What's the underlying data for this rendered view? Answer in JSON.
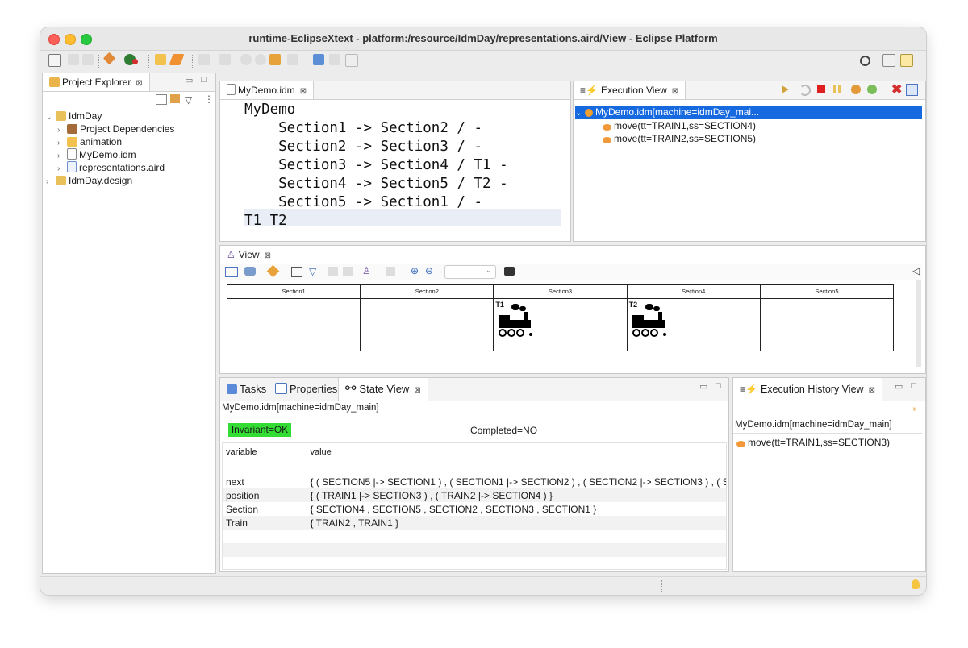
{
  "window": {
    "title": "runtime-EclipseXtext - platform:/resource/IdmDay/representations.aird/View - Eclipse Platform"
  },
  "colors": {
    "selection": "#1769e0",
    "invariant_ok": "#33dd33"
  },
  "project_explorer": {
    "tab_label": "Project Explorer",
    "tree": [
      {
        "label": "IdmDay",
        "icon": "project-folder-icon",
        "expanded": true
      },
      {
        "label": "Project Dependencies",
        "icon": "library-icon"
      },
      {
        "label": "animation",
        "icon": "folder-icon"
      },
      {
        "label": "MyDemo.idm",
        "icon": "file-icon"
      },
      {
        "label": "representations.aird",
        "icon": "aird-file-icon"
      },
      {
        "label": "IdmDay.design",
        "icon": "project-folder-icon"
      }
    ]
  },
  "editor": {
    "tab_label": "MyDemo.idm",
    "lines": [
      "MyDemo",
      "    Section1 -> Section2 / -",
      "    Section2 -> Section3 / -",
      "    Section3 -> Section4 / T1 -",
      "    Section4 -> Section5 / T2 -",
      "    Section5 -> Section1 / -",
      "T1 T2"
    ]
  },
  "execution_view": {
    "tab_label": "Execution View",
    "root": "MyDemo.idm[machine=idmDay_mai...",
    "items": [
      "move(tt=TRAIN1,ss=SECTION4)",
      "move(tt=TRAIN2,ss=SECTION5)"
    ]
  },
  "view": {
    "tab_label": "View",
    "sections": [
      "Section1",
      "Section2",
      "Section3",
      "Section4",
      "Section5"
    ],
    "trains": [
      {
        "label": "T1",
        "section": "Section3"
      },
      {
        "label": "T2",
        "section": "Section4"
      }
    ]
  },
  "bottom_tabs": {
    "tasks": "Tasks",
    "properties": "Properties",
    "state_view": "State View"
  },
  "state_view": {
    "machine": "MyDemo.idm[machine=idmDay_main]",
    "invariant": "Invariant=OK",
    "completed": "Completed=NO",
    "headers": [
      "variable",
      "value"
    ],
    "rows": [
      [
        "next",
        "{ ( SECTION5 |-> SECTION1 ) , ( SECTION1 |-> SECTION2 ) , ( SECTION2 |-> SECTION3 ) , ( S"
      ],
      [
        "position",
        "{ ( TRAIN1 |-> SECTION3 ) , ( TRAIN2 |-> SECTION4 ) }"
      ],
      [
        "Section",
        "{ SECTION4 , SECTION5 , SECTION2 , SECTION3 , SECTION1 }"
      ],
      [
        "Train",
        "{ TRAIN2 , TRAIN1 }"
      ]
    ]
  },
  "history_view": {
    "tab_label": "Execution History View",
    "machine": "MyDemo.idm[machine=idmDay_main]",
    "items": [
      "move(tt=TRAIN1,ss=SECTION3)"
    ]
  }
}
